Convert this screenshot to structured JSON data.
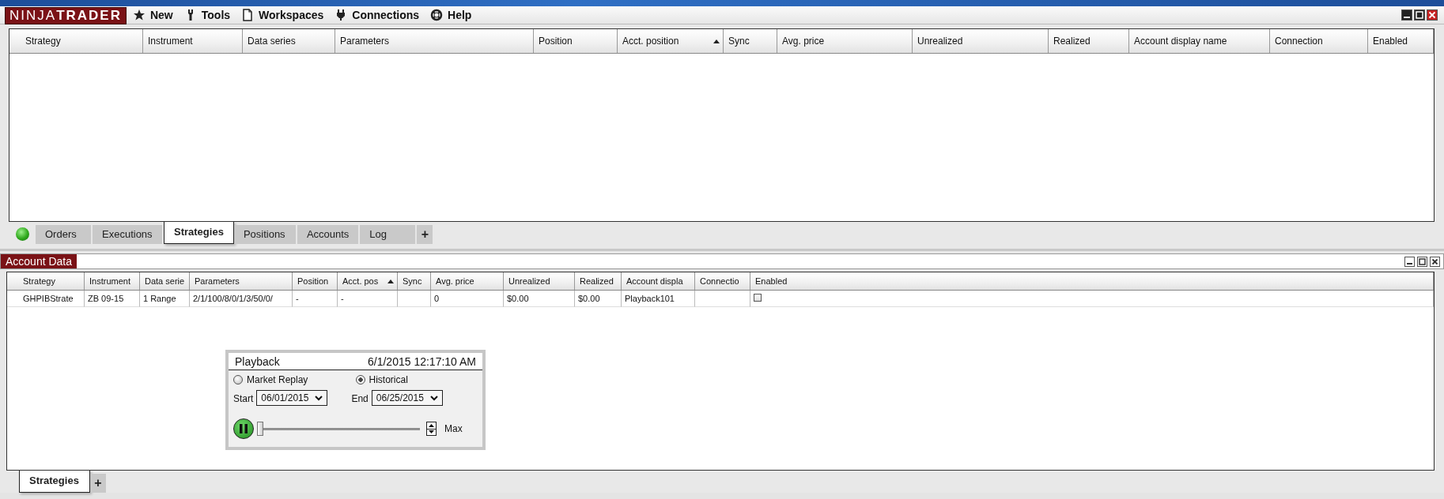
{
  "app": {
    "logo": "NINJA**TRADER**"
  },
  "menu": [
    {
      "label": "New",
      "kind": "star"
    },
    {
      "label": "Tools",
      "kind": "wrench"
    },
    {
      "label": "Workspaces",
      "kind": "page"
    },
    {
      "label": "Connections",
      "kind": "plug"
    },
    {
      "label": "Help",
      "kind": "lifebuoy"
    }
  ],
  "top_table": {
    "columns": [
      {
        "label": "Strategy",
        "sorted": false
      },
      {
        "label": "Instrument",
        "sorted": false
      },
      {
        "label": "Data series",
        "sorted": false
      },
      {
        "label": "Parameters",
        "sorted": false
      },
      {
        "label": "Position",
        "sorted": false
      },
      {
        "label": "Acct. position",
        "sorted": true
      },
      {
        "label": "Sync",
        "sorted": false
      },
      {
        "label": "Avg. price",
        "sorted": false
      },
      {
        "label": "Unrealized",
        "sorted": false
      },
      {
        "label": "Realized",
        "sorted": false
      },
      {
        "label": "Account display name",
        "sorted": false
      },
      {
        "label": "Connection",
        "sorted": false
      },
      {
        "label": "Enabled",
        "sorted": false
      }
    ]
  },
  "top_tabs": {
    "items": [
      {
        "label": "Orders",
        "selected": false
      },
      {
        "label": "Executions",
        "selected": false
      },
      {
        "label": "Strategies",
        "selected": true
      },
      {
        "label": "Positions",
        "selected": false
      },
      {
        "label": "Accounts",
        "selected": false
      },
      {
        "label": "Log",
        "selected": false
      }
    ],
    "add": "+"
  },
  "account_panel": {
    "title": "Account Data",
    "columns": [
      {
        "label": "Strategy",
        "sorted": false
      },
      {
        "label": "Instrument",
        "sorted": false
      },
      {
        "label": "Data serie",
        "sorted": false
      },
      {
        "label": "Parameters",
        "sorted": false
      },
      {
        "label": "Position",
        "sorted": false
      },
      {
        "label": "Acct. pos",
        "sorted": true
      },
      {
        "label": "Sync",
        "sorted": false
      },
      {
        "label": "Avg. price",
        "sorted": false
      },
      {
        "label": "Unrealized",
        "sorted": false
      },
      {
        "label": "Realized",
        "sorted": false
      },
      {
        "label": "Account displa",
        "sorted": false
      },
      {
        "label": "Connectio",
        "sorted": false
      },
      {
        "label": "Enabled",
        "sorted": false
      }
    ],
    "rows": [
      {
        "cells": [
          "GHPIBStrate",
          "ZB 09-15",
          "1 Range",
          "2/1/100/8/0/1/3/50/0/",
          "-",
          "-",
          "",
          "0",
          "$0.00",
          "$0.00",
          "Playback101",
          ""
        ],
        "enabled": false
      }
    ],
    "tabs": [
      {
        "label": "Strategies",
        "selected": true
      }
    ],
    "add": "+"
  },
  "playback": {
    "title": "Playback",
    "time": "6/1/2015 12:17:10 AM",
    "modes": [
      {
        "label": "Market Replay",
        "selected": false
      },
      {
        "label": "Historical",
        "selected": true
      }
    ],
    "start": {
      "label": "Start",
      "value": "06/01/2015"
    },
    "end": {
      "label": "End",
      "value": "06/25/2015"
    },
    "level": 0,
    "speed": "Max"
  }
}
